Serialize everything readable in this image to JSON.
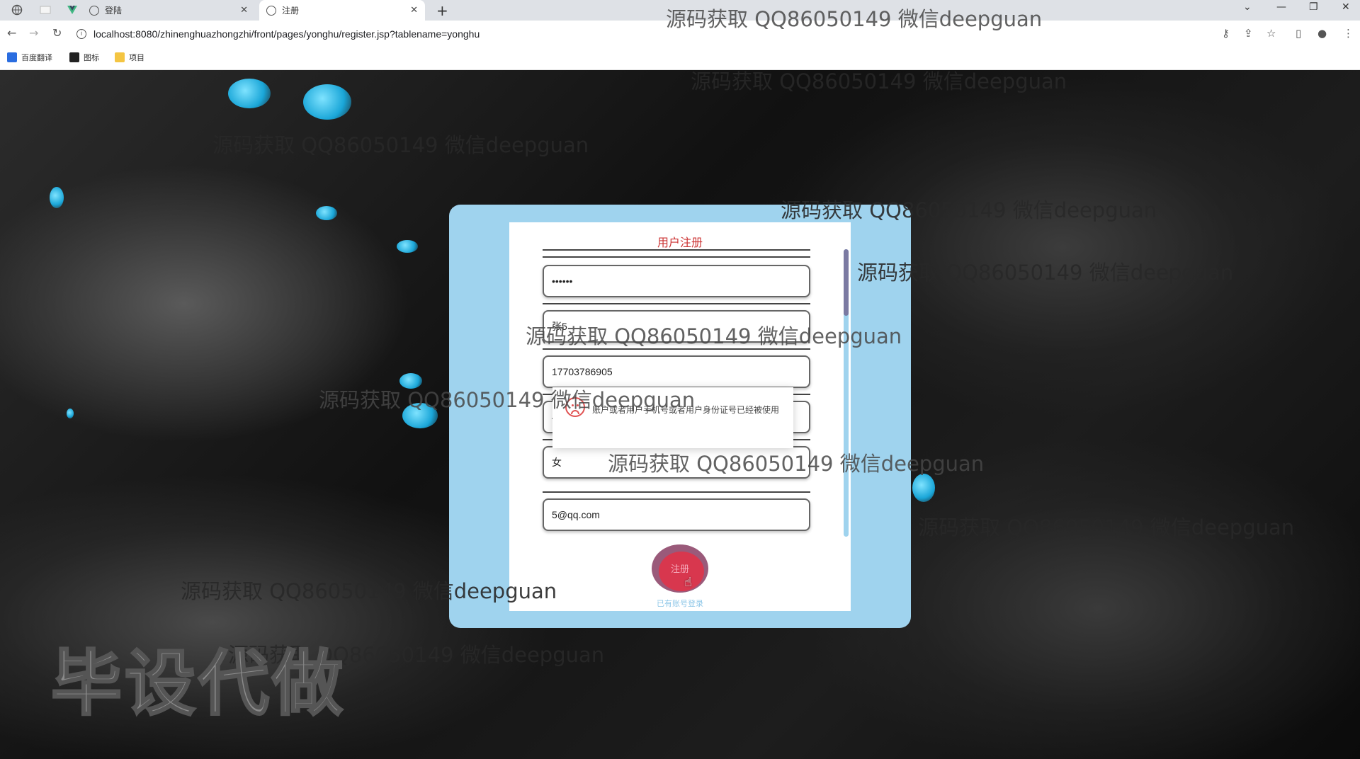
{
  "browser": {
    "tabs": [
      {
        "label": "",
        "active": false
      },
      {
        "label": "",
        "active": false
      },
      {
        "label": "",
        "active": false
      },
      {
        "label": "登陆",
        "active": false
      },
      {
        "label": "注册",
        "active": true
      }
    ],
    "url": "localhost:8080/zhinenghuazhongzhi/front/pages/yonghu/register.jsp?tablename=yonghu",
    "bookmarks": [
      "百度翻译",
      "图标",
      "项目"
    ]
  },
  "register": {
    "title": "用户注册",
    "fields": {
      "password": "••••••",
      "name": "张5",
      "phone": "17703786905",
      "idcard": "4",
      "gender": "女",
      "email": "5@qq.com"
    },
    "button_label": "注册",
    "login_link": "已有账号登录"
  },
  "toast": {
    "message": "账户或者用户手机号或者用户身份证号已经被使用"
  },
  "watermarks": {
    "text": "源码获取 QQ86050149 微信deepguan",
    "big": "毕设代做"
  }
}
